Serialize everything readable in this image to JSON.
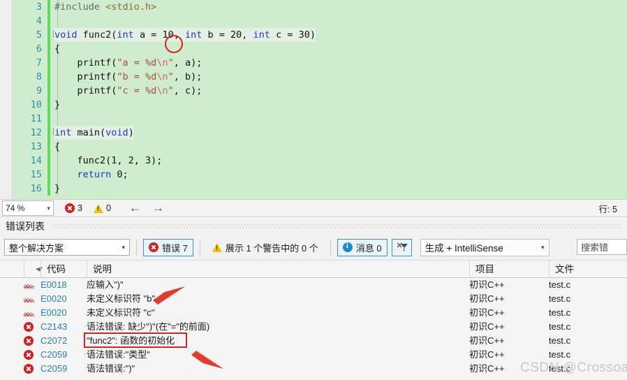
{
  "editor": {
    "background_color": "#cfeccf",
    "lines": [
      {
        "num": "3",
        "indent": 0,
        "fold": false,
        "tokens": [
          {
            "t": "#include ",
            "c": "pre"
          },
          {
            "t": "<stdio.h>",
            "c": "hdr"
          }
        ]
      },
      {
        "num": "4",
        "indent": 0,
        "fold": false,
        "tokens": []
      },
      {
        "num": "5",
        "indent": 0,
        "fold": true,
        "tokens": [
          {
            "t": "void",
            "c": "kw"
          },
          {
            "t": " func2(",
            "c": "id"
          },
          {
            "t": "int",
            "c": "kw"
          },
          {
            "t": " a = ",
            "c": "id"
          },
          {
            "t": "10",
            "c": "num"
          },
          {
            "t": ", ",
            "c": "id"
          },
          {
            "t": "int",
            "c": "kw"
          },
          {
            "t": " b = ",
            "c": "id"
          },
          {
            "t": "20",
            "c": "num"
          },
          {
            "t": ", ",
            "c": "id"
          },
          {
            "t": "int",
            "c": "kw"
          },
          {
            "t": " c = ",
            "c": "id"
          },
          {
            "t": "30",
            "c": "num"
          },
          {
            "t": ")",
            "c": "id"
          }
        ]
      },
      {
        "num": "6",
        "indent": 0,
        "fold": false,
        "tokens": [
          {
            "t": "{",
            "c": "id"
          }
        ]
      },
      {
        "num": "7",
        "indent": 0,
        "fold": false,
        "tokens": [
          {
            "t": "    printf(",
            "c": "id"
          },
          {
            "t": "\"a = %d",
            "c": "str"
          },
          {
            "t": "\\n",
            "c": "esc"
          },
          {
            "t": "\"",
            "c": "str"
          },
          {
            "t": ", a);",
            "c": "id"
          }
        ]
      },
      {
        "num": "8",
        "indent": 0,
        "fold": false,
        "tokens": [
          {
            "t": "    printf(",
            "c": "id"
          },
          {
            "t": "\"b = %d",
            "c": "str"
          },
          {
            "t": "\\n",
            "c": "esc"
          },
          {
            "t": "\"",
            "c": "str"
          },
          {
            "t": ", b);",
            "c": "id"
          }
        ]
      },
      {
        "num": "9",
        "indent": 0,
        "fold": false,
        "tokens": [
          {
            "t": "    printf(",
            "c": "id"
          },
          {
            "t": "\"c = %d",
            "c": "str"
          },
          {
            "t": "\\n",
            "c": "esc"
          },
          {
            "t": "\"",
            "c": "str"
          },
          {
            "t": ", c);",
            "c": "id"
          }
        ]
      },
      {
        "num": "10",
        "indent": 0,
        "fold": false,
        "tokens": [
          {
            "t": "}",
            "c": "id"
          }
        ]
      },
      {
        "num": "11",
        "indent": 0,
        "fold": false,
        "tokens": []
      },
      {
        "num": "12",
        "indent": 0,
        "fold": true,
        "tokens": [
          {
            "t": "int",
            "c": "kw"
          },
          {
            "t": " main(",
            "c": "id"
          },
          {
            "t": "void",
            "c": "kw"
          },
          {
            "t": ")",
            "c": "id"
          }
        ]
      },
      {
        "num": "13",
        "indent": 0,
        "fold": false,
        "tokens": [
          {
            "t": "{",
            "c": "id"
          }
        ]
      },
      {
        "num": "14",
        "indent": 0,
        "fold": false,
        "tokens": [
          {
            "t": "    func2(1, 2, 3);",
            "c": "id"
          }
        ]
      },
      {
        "num": "15",
        "indent": 0,
        "fold": false,
        "tokens": [
          {
            "t": "    ",
            "c": "id"
          },
          {
            "t": "return",
            "c": "kw"
          },
          {
            "t": " 0;",
            "c": "id"
          }
        ]
      },
      {
        "num": "16",
        "indent": 0,
        "fold": false,
        "tokens": [
          {
            "t": "}",
            "c": "id"
          }
        ]
      }
    ]
  },
  "status_bar": {
    "zoom_level": "74 %",
    "error_count": "3",
    "warning_count": "0",
    "back_arrow": "←",
    "forward_arrow": "→",
    "caret_position": "行: 5"
  },
  "panel": {
    "title": "错误列表",
    "toolbar": {
      "scope_selected": "整个解决方案",
      "errors_label": "错误 7",
      "warnings_label": "展示 1 个警告中的 0 个",
      "messages_label": "消息 0",
      "clear_filter_label": "",
      "build_source_selected": "生成 + IntelliSense",
      "caret_glyph": "▾"
    },
    "search": {
      "placeholder": "搜索错",
      "value": "搜索错"
    },
    "columns": [
      {
        "key": "severity",
        "label": ""
      },
      {
        "key": "code",
        "label": "代码"
      },
      {
        "key": "description",
        "label": "说明"
      },
      {
        "key": "project",
        "label": "项目"
      },
      {
        "key": "file",
        "label": "文件"
      }
    ],
    "rows": [
      {
        "icon": "intellisense-squiggle-icon",
        "code": "E0018",
        "description": "应输入\")\"",
        "project": "初识C++",
        "file": "test.c"
      },
      {
        "icon": "intellisense-squiggle-icon",
        "code": "E0020",
        "description": "未定义标识符 \"b\"",
        "project": "初识C++",
        "file": "test.c"
      },
      {
        "icon": "intellisense-squiggle-icon",
        "code": "E0020",
        "description": "未定义标识符 \"c\"",
        "project": "初识C++",
        "file": "test.c"
      },
      {
        "icon": "error-icon",
        "code": "C2143",
        "description": "语法错误: 缺少\")\"(在\"=\"的前面)",
        "project": "初识C++",
        "file": "test.c"
      },
      {
        "icon": "error-icon",
        "code": "C2072",
        "description": "\"func2\": 函数的初始化",
        "project": "初识C++",
        "file": "test.c"
      },
      {
        "icon": "error-icon",
        "code": "C2059",
        "description": "语法错误:\"类型\"",
        "project": "初识C++",
        "file": "test.c"
      },
      {
        "icon": "error-icon",
        "code": "C2059",
        "description": "语法错误:\")\"",
        "project": "初识C++",
        "file": "test.c"
      }
    ]
  },
  "annotations": {
    "accent_color": "#e02020",
    "ellipse_target": "=",
    "arrow_1_target": "未定义标识符 \"b\"",
    "arrow_2_target": "语法错误:\"类型\"",
    "box_target": "\"func2\": 函数的初始化"
  },
  "watermark": {
    "text": "CSDN @Crossoads("
  }
}
